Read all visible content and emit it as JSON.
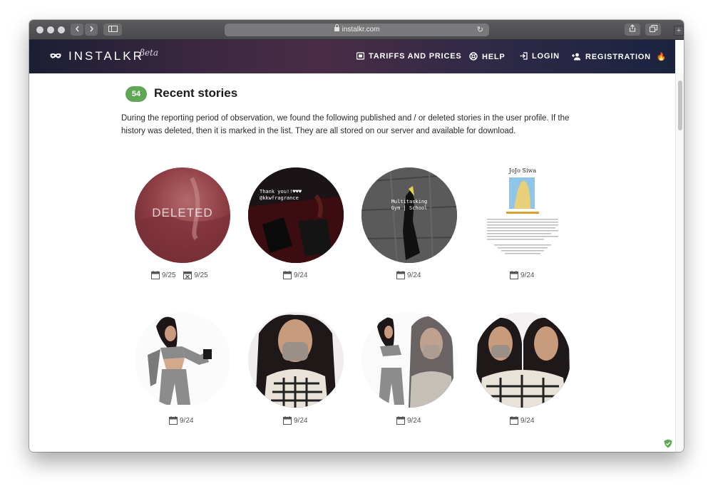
{
  "browser": {
    "url": "instalkr.com"
  },
  "header": {
    "logo": "INSTALKR",
    "beta": "βeta",
    "nav": [
      {
        "label": "TARIFFS AND PRICES",
        "icon": "price-tag-icon"
      },
      {
        "label": "HELP",
        "icon": "help-circle-icon"
      },
      {
        "label": "LOGIN",
        "icon": "login-icon"
      },
      {
        "label": "REGISTRATION",
        "icon": "add-user-icon",
        "suffix": "🔥"
      }
    ]
  },
  "main": {
    "count": "54",
    "title": "Recent stories",
    "description": "During the reporting period of observation, we found the following published and / or deleted stories in the user profile. If the history was deleted, then it is marked in the list. They are all stored on our server and available for download."
  },
  "stories": [
    {
      "date": "9/25",
      "deleted": true,
      "deleted_date": "9/25",
      "overlay_label": "DELETED"
    },
    {
      "date": "9/24",
      "deleted": false,
      "overlay_text": [
        "Thank you!!♥♥♥",
        "@kkwfragrance"
      ]
    },
    {
      "date": "9/24",
      "deleted": false,
      "overlay_text": [
        "Multitasking",
        "Gym | School"
      ]
    },
    {
      "date": "9/24",
      "deleted": false,
      "overlay_text": [
        "JoJo Siwa"
      ]
    },
    {
      "date": "9/24",
      "deleted": false
    },
    {
      "date": "9/24",
      "deleted": false
    },
    {
      "date": "9/24",
      "deleted": false
    },
    {
      "date": "9/24",
      "deleted": false
    }
  ],
  "colors": {
    "accent_badge": "#5fa755",
    "header_gradient_start": "#1b1e33",
    "header_gradient_end": "#1b2340"
  }
}
